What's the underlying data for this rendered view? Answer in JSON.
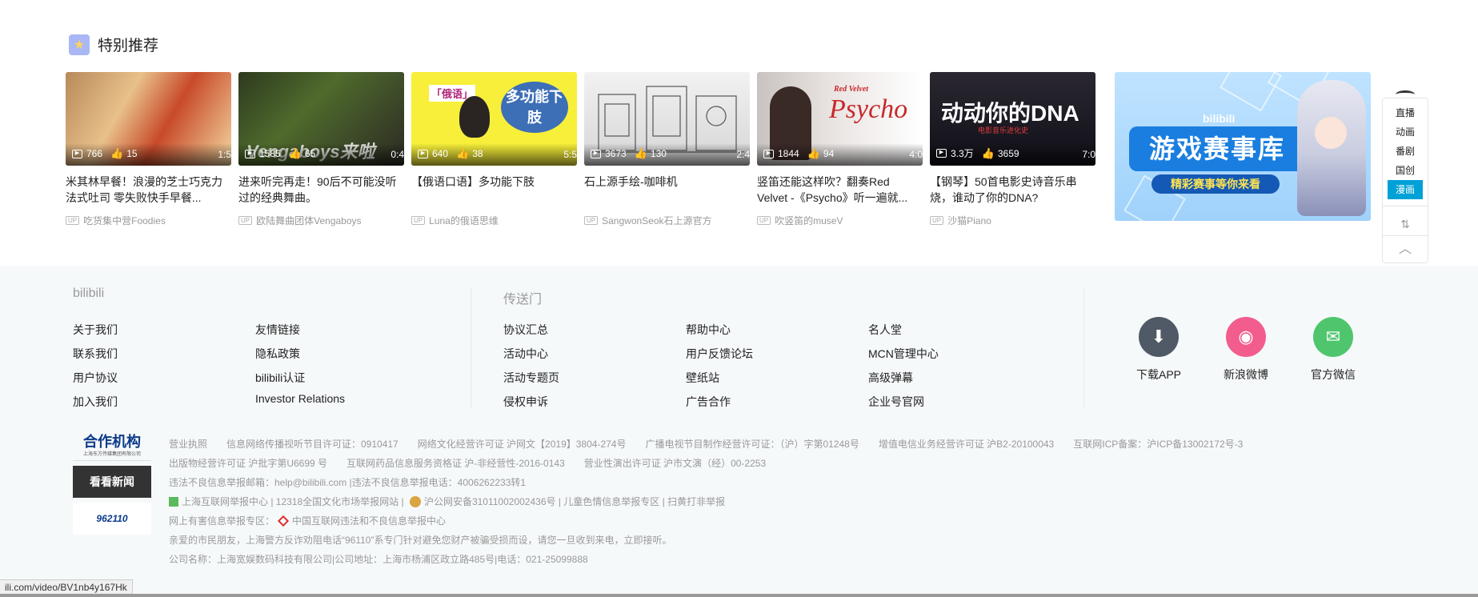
{
  "section": {
    "title": "特别推荐",
    "icon": "star-icon"
  },
  "cards": [
    {
      "views": "766",
      "likes": "15",
      "duration": "1:5",
      "title": "米其林早餐！浪漫的芝士巧克力法式吐司 零失败快手早餐...",
      "uploader": "吃货集中营Foodies"
    },
    {
      "views": "1585",
      "likes": "65",
      "duration": "0:4",
      "title": "进来听完再走！90后不可能没听过的经典舞曲。",
      "uploader": "欧陆舞曲团体Vengaboys",
      "overlay": "Vengaboys来啦"
    },
    {
      "views": "640",
      "likes": "38",
      "duration": "5:5",
      "title": "【俄语口语】多功能下肢",
      "uploader": "Luna的俄语思维",
      "overlay_tag": "「俄语」",
      "overlay": "多功能下肢"
    },
    {
      "views": "3673",
      "likes": "130",
      "duration": "2:4",
      "title": "石上源手绘-咖啡机",
      "uploader": "SangwonSeok石上源官方"
    },
    {
      "views": "1844",
      "likes": "94",
      "duration": "4:0",
      "title": "竖笛还能这样吹？翻奏Red Velvet -《Psycho》听一遍就...",
      "uploader": "吹竖笛的museV",
      "overlay_tag": "Red Velvet",
      "overlay": "Psycho"
    },
    {
      "views": "3.3万",
      "likes": "3659",
      "duration": "7:0",
      "title": "【钢琴】50首电影史诗音乐串烧，谁动了你的DNA?",
      "uploader": "沙猫Piano",
      "overlay": "动动你的DNA",
      "overlay_sub": "电影音乐进化史"
    }
  ],
  "up_tag": "UP",
  "banner": {
    "brand": "bilibili",
    "title": "游戏赛事库",
    "subtitle": "精彩赛事等你来看"
  },
  "sidenav": {
    "items": [
      "直播",
      "动画",
      "番剧",
      "国创",
      "漫画"
    ],
    "active_index": 4
  },
  "footer": {
    "col1_title": "bilibili",
    "col1": [
      "关于我们",
      "联系我们",
      "用户协议",
      "加入我们"
    ],
    "col2": [
      "友情链接",
      "隐私政策",
      "bilibili认证",
      "Investor Relations"
    ],
    "col3_title": "传送门",
    "col3": [
      "协议汇总",
      "活动中心",
      "活动专题页",
      "侵权申诉"
    ],
    "col4": [
      "帮助中心",
      "用户反馈论坛",
      "壁纸站",
      "广告合作"
    ],
    "col5": [
      "名人堂",
      "MCN管理中心",
      "高级弹幕",
      "企业号官网"
    ],
    "apps": [
      {
        "label": "下载APP",
        "icon": "download-icon",
        "color": "#505a66"
      },
      {
        "label": "新浪微博",
        "icon": "weibo-icon",
        "color": "#f25d8e"
      },
      {
        "label": "官方微信",
        "icon": "wechat-icon",
        "color": "#4fc66e"
      }
    ],
    "partners": {
      "p1": "合作机构",
      "p1_small": "上海东方传媒集团有限公司",
      "p2": "看看新闻",
      "p3": "962110"
    },
    "licenses": [
      "营业执照　　信息网络传播视听节目许可证：0910417　　网络文化经营许可证 沪网文【2019】3804-274号　　广播电视节目制作经营许可证：（沪）字第01248号　　增值电信业务经营许可证 沪B2-20100043　　互联网ICP备案：沪ICP备13002172号-3",
      "出版物经营许可证 沪批字第U6699 号　　互联网药品信息服务资格证 沪-非经营性-2016-0143　　营业性演出许可证 沪市文演（经）00-2253",
      "违法不良信息举报邮箱：help@bilibili.com |违法不良信息举报电话：4006262233转1",
      "上海互联网举报中心 | 12318全国文化市场举报网站 |",
      "沪公网安备31011002002436号 | 儿童色情信息举报专区 | 扫黄打非举报",
      "网上有害信息举报专区：",
      "中国互联网违法和不良信息举报中心",
      "亲爱的市民朋友，上海警方反诈劝阻电话“96110”系专门针对避免您财产被骗受损而设，请您一旦收到来电，立即接听。",
      "公司名称：上海宽娱数码科技有限公司|公司地址：上海市杨浦区政立路485号|电话：021-25099888"
    ]
  },
  "status_url": "ili.com/video/BV1nb4y167Hk"
}
